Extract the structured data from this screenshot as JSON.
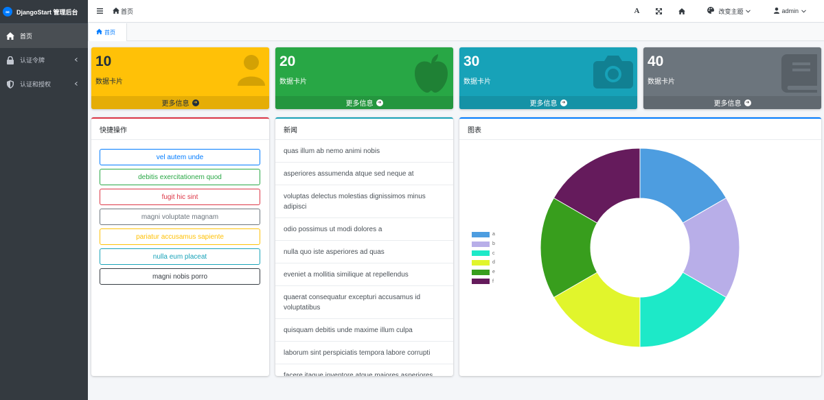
{
  "brand": {
    "title": "DjangoStart 管理后台"
  },
  "sidebar": {
    "items": [
      {
        "label": "首页",
        "icon": "home-icon",
        "active": true
      },
      {
        "label": "认证令牌",
        "icon": "lock-icon",
        "expandable": true
      },
      {
        "label": "认证和授权",
        "icon": "shield-icon",
        "expandable": true
      }
    ]
  },
  "navbar": {
    "breadcrumb": "首页",
    "theme_label": "改变主题",
    "user_label": "admin"
  },
  "tabs": [
    {
      "label": "首页"
    }
  ],
  "cards": [
    {
      "value": "10",
      "label": "数据卡片",
      "more": "更多信息",
      "icon": "user-icon",
      "color": "#ffc107"
    },
    {
      "value": "20",
      "label": "数据卡片",
      "more": "更多信息",
      "icon": "apple-icon",
      "color": "#28a745"
    },
    {
      "value": "30",
      "label": "数据卡片",
      "more": "更多信息",
      "icon": "camera-icon",
      "color": "#17a2b8"
    },
    {
      "value": "40",
      "label": "数据卡片",
      "more": "更多信息",
      "icon": "book-icon",
      "color": "#6c757d"
    }
  ],
  "quick": {
    "title": "快捷操作",
    "buttons": [
      {
        "label": "vel autem unde",
        "color": "#007bff"
      },
      {
        "label": "debitis exercitationem quod",
        "color": "#28a745"
      },
      {
        "label": "fugit hic sint",
        "color": "#dc3545"
      },
      {
        "label": "magni voluptate magnam",
        "color": "#6c757d"
      },
      {
        "label": "pariatur accusamus sapiente",
        "color": "#ffc107"
      },
      {
        "label": "nulla eum placeat",
        "color": "#17a2b8"
      },
      {
        "label": "magni nobis porro",
        "color": "#343a40"
      }
    ]
  },
  "news": {
    "title": "新闻",
    "items": [
      "quas illum ab nemo animi nobis",
      "asperiores assumenda atque sed neque at",
      "voluptas delectus molestias dignissimos minus adipisci",
      "odio possimus ut modi dolores a",
      "nulla quo iste asperiores ad quas",
      "eveniet a mollitia similique at repellendus",
      "quaerat consequatur excepturi accusamus id voluptatibus",
      "quisquam debitis unde maxime illum culpa",
      "laborum sint perspiciatis tempora labore corrupti",
      "facere itaque inventore atque maiores asperiores"
    ]
  },
  "chart_panel": {
    "title": "图表"
  },
  "chart_data": {
    "type": "pie",
    "categories": [
      "a",
      "b",
      "c",
      "d",
      "e",
      "f"
    ],
    "values": [
      1,
      1,
      1,
      1,
      1,
      1
    ],
    "colors": [
      "#4d9de0",
      "#b8aee8",
      "#1de9c8",
      "#e1f52c",
      "#389e1d",
      "#651b5c"
    ],
    "donut": true,
    "legend": "left"
  }
}
